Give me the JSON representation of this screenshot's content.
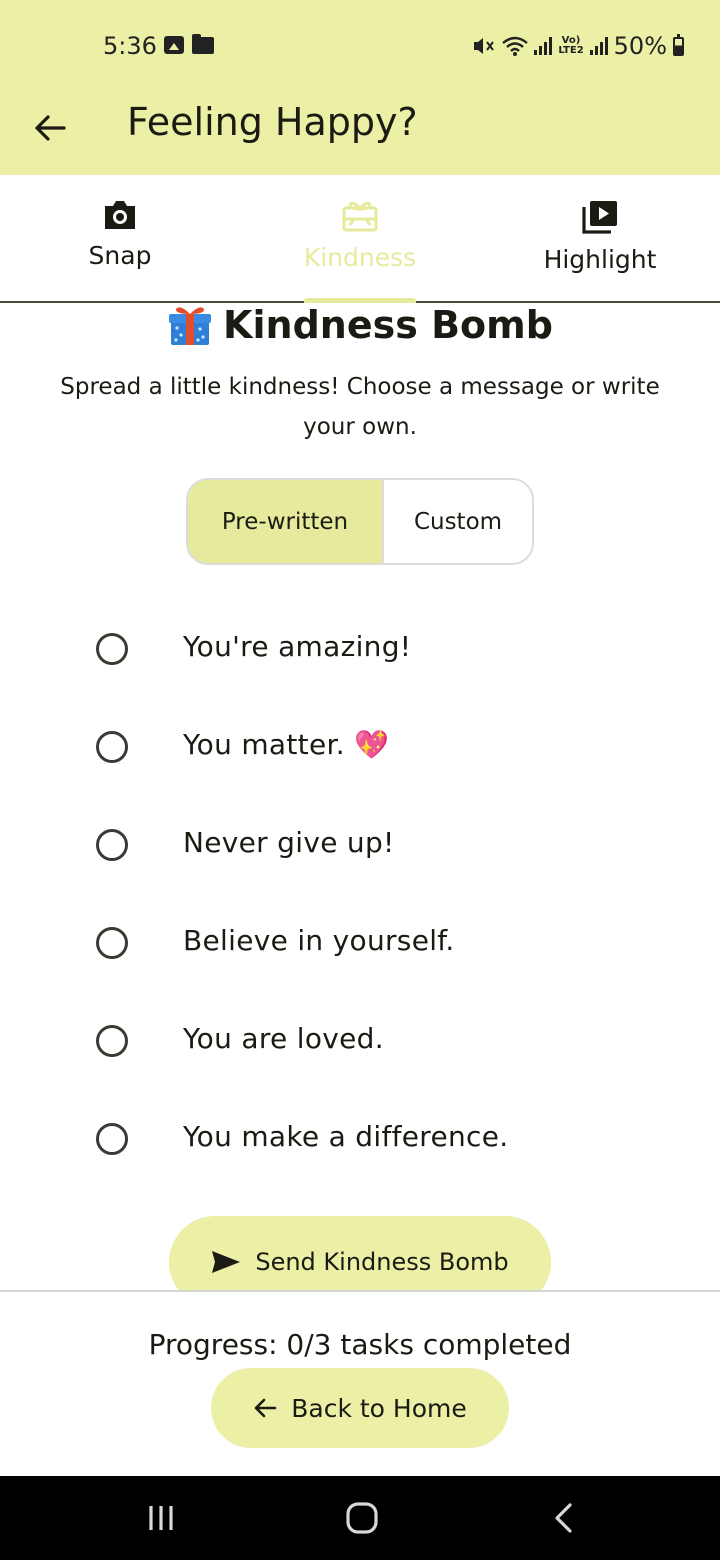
{
  "status_bar": {
    "time": "5:36",
    "battery": "50%",
    "network_label": "LTE2",
    "icons": [
      "image-icon",
      "folder-icon",
      "mute-icon",
      "wifi-icon",
      "signal-icon",
      "volte-icon",
      "signal-icon",
      "battery-icon"
    ]
  },
  "app_bar": {
    "title": "Feeling Happy?",
    "back_icon": "arrow-left-icon"
  },
  "tabs": [
    {
      "label": "Snap",
      "icon": "camera-icon",
      "active": false
    },
    {
      "label": "Kindness",
      "icon": "gift-card-icon",
      "active": true
    },
    {
      "label": "Highlight",
      "icon": "video-library-icon",
      "active": false
    }
  ],
  "main": {
    "heading_emoji": "🎁",
    "heading": "Kindness Bomb",
    "description": "Spread a little kindness! Choose a message or write your own.",
    "segments": {
      "prewritten": "Pre-written",
      "custom": "Custom",
      "selected": "Pre-written"
    },
    "options": [
      {
        "label": "You're amazing!",
        "selected": false
      },
      {
        "label": "You matter. 💖",
        "selected": false
      },
      {
        "label": "Never give up!",
        "selected": false
      },
      {
        "label": "Believe in yourself.",
        "selected": false
      },
      {
        "label": "You are loved.",
        "selected": false
      },
      {
        "label": "You make a difference.",
        "selected": false
      }
    ],
    "send_button": "Send Kindness Bomb"
  },
  "footer": {
    "progress": "Progress: 0/3 tasks completed",
    "back_home": "Back to Home"
  },
  "colors": {
    "accent": "#ecefa6",
    "accent_active": "#e6ea9c",
    "text": "#1c1b13",
    "nav_bar": "#000000"
  }
}
